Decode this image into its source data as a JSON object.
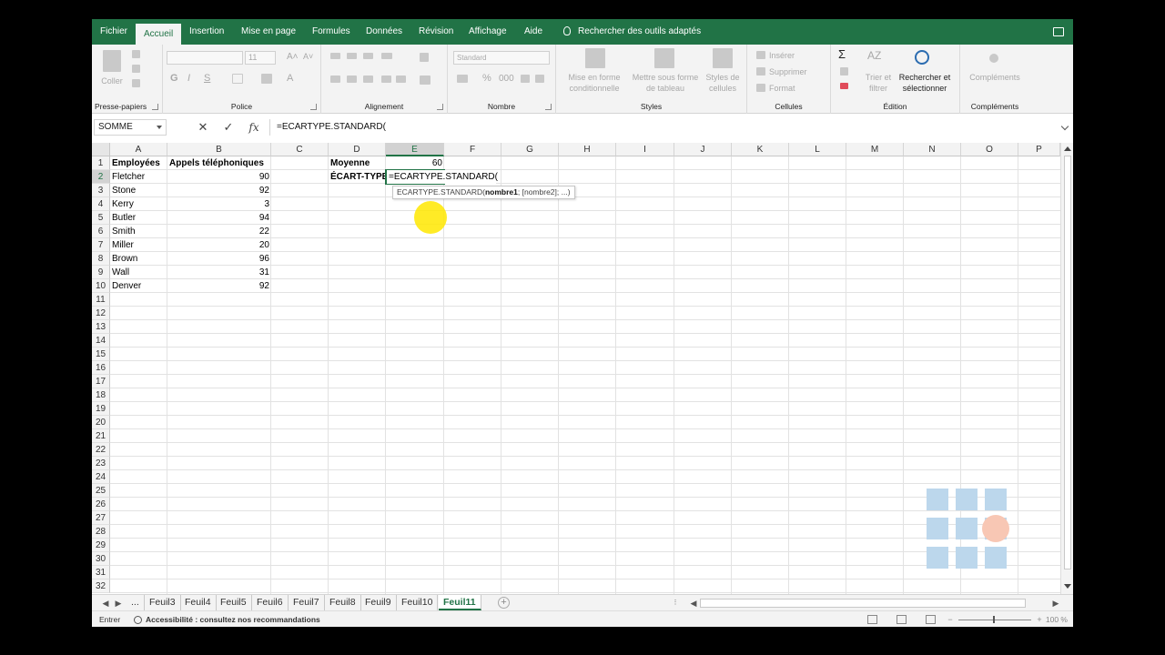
{
  "ribbon_tabs": [
    "Fichier",
    "Accueil",
    "Insertion",
    "Mise en page",
    "Formules",
    "Données",
    "Révision",
    "Affichage",
    "Aide"
  ],
  "tell_me": "Rechercher des outils adaptés",
  "ribbon": {
    "clipboard": {
      "paste": "Coller",
      "label": "Presse-papiers"
    },
    "font": {
      "size": "11",
      "bold": "G",
      "italic": "I",
      "underline": "S",
      "label": "Police"
    },
    "alignment": {
      "label": "Alignement"
    },
    "number": {
      "format": "Standard",
      "label": "Nombre"
    },
    "styles": {
      "conditional": "Mise en forme conditionnelle",
      "as_table": "Mettre sous forme de tableau",
      "cell_styles": "Styles de cellules",
      "label": "Styles"
    },
    "cells": {
      "insert": "Insérer",
      "delete": "Supprimer",
      "format": "Format",
      "label": "Cellules"
    },
    "editing": {
      "sort": "Trier et filtrer",
      "find": "Rechercher et sélectionner",
      "label": "Édition"
    },
    "addins": {
      "addins": "Compléments",
      "label": "Compléments"
    }
  },
  "formula_bar": {
    "name_box": "SOMME",
    "cancel": "✕",
    "enter": "✓",
    "fx": "fx",
    "formula": "=ECARTYPE.STANDARD("
  },
  "columns": [
    "A",
    "B",
    "C",
    "D",
    "E",
    "F",
    "G",
    "H",
    "I",
    "J",
    "K",
    "L",
    "M",
    "N",
    "O",
    "P"
  ],
  "rows": [
    "1",
    "2",
    "3",
    "4",
    "5",
    "6",
    "7",
    "8",
    "9",
    "10",
    "11",
    "12",
    "13",
    "14",
    "15",
    "16",
    "17",
    "18",
    "19",
    "20",
    "21",
    "22",
    "23",
    "24",
    "25",
    "26",
    "27",
    "28",
    "29",
    "30",
    "31",
    "32"
  ],
  "sheet": {
    "header_a": "Employées",
    "header_b": "Appels téléphoniques",
    "employees": [
      "Fletcher",
      "Stone",
      "Kerry",
      "Butler",
      "Smith",
      "Miller",
      "Brown",
      "Wall",
      "Denver"
    ],
    "calls": [
      "90",
      "92",
      "3",
      "94",
      "22",
      "20",
      "96",
      "31",
      "92"
    ],
    "label_mean": "Moyenne",
    "value_mean": "60",
    "label_stdev": "ÉCART-TYPE",
    "active_cell_text": "=ECARTYPE.STANDARD("
  },
  "tooltip": {
    "func": "ECARTYPE.STANDARD(",
    "arg1": "nombre1",
    "rest": "; [nombre2]; ...)"
  },
  "sheet_tabs": [
    "...",
    "Feuil3",
    "Feuil4",
    "Feuil5",
    "Feuil6",
    "Feuil7",
    "Feuil8",
    "Feuil9",
    "Feuil10",
    "Feuil11"
  ],
  "active_sheet": "Feuil11",
  "status": {
    "mode": "Entrer",
    "accessibility": "Accessibilité : consultez nos recommandations",
    "zoom": "100 %"
  },
  "colors": {
    "accent": "#217346",
    "cursor_highlight": "#ffe800"
  }
}
